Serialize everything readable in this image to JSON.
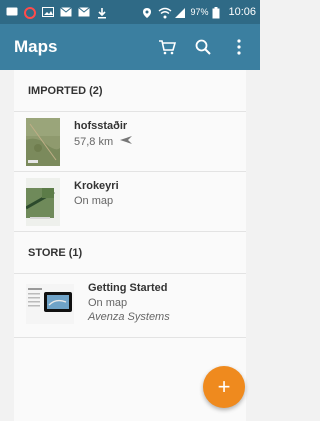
{
  "status_bar": {
    "battery": "97%",
    "time": "10:06",
    "icons": [
      "message-icon",
      "circle-app-icon",
      "image-icon",
      "mail-icon",
      "mail-icon",
      "download-icon",
      "location-icon",
      "wifi-icon",
      "signal-icon",
      "battery-icon"
    ]
  },
  "app_bar": {
    "title": "Maps",
    "actions": [
      "store-cart-icon",
      "search-icon",
      "more-vert-icon"
    ]
  },
  "sections": {
    "imported": {
      "header": "IMPORTED (2)",
      "items": [
        {
          "title": "hofsstaðir",
          "subtitle": "57,8 km",
          "icon": "direction-arrow-icon"
        },
        {
          "title": "Krokeyri",
          "subtitle": "On map"
        }
      ]
    },
    "store": {
      "header": "STORE (1)",
      "items": [
        {
          "title": "Getting Started",
          "subtitle": "On map",
          "publisher": "Avenza Systems"
        }
      ]
    }
  },
  "fab": {
    "label": "+",
    "color": "#ef8a1e"
  },
  "colors": {
    "status_bar": "#2f6a86",
    "app_bar": "#3b7fa0",
    "accent": "#ef8a1e"
  }
}
